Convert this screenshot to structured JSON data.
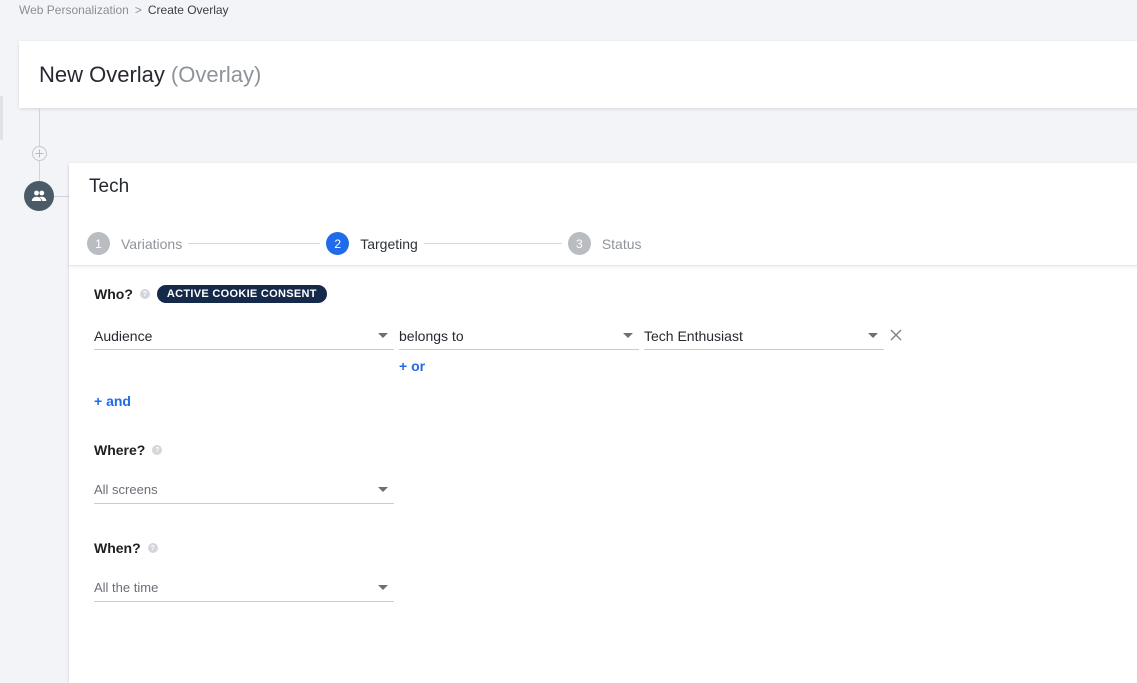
{
  "breadcrumb": {
    "parent": "Web Personalization",
    "separator": ">",
    "current": "Create Overlay"
  },
  "header": {
    "title": "New Overlay",
    "type_label": "(Overlay)"
  },
  "timeline": {
    "add_icon": "plus-icon",
    "node_icon": "people-icon"
  },
  "card": {
    "title": "Tech",
    "steps": [
      {
        "number": "1",
        "label": "Variations",
        "active": false
      },
      {
        "number": "2",
        "label": "Targeting",
        "active": true
      },
      {
        "number": "3",
        "label": "Status",
        "active": false
      }
    ]
  },
  "who": {
    "label": "Who?",
    "help": "?",
    "badge": "ACTIVE COOKIE CONSENT",
    "condition": {
      "field": "Audience",
      "operator": "belongs to",
      "value": "Tech Enthusiast"
    },
    "or_label": "+ or",
    "and_label": "+ and"
  },
  "where": {
    "label": "Where?",
    "help": "?",
    "value": "All screens"
  },
  "when": {
    "label": "When?",
    "help": "?",
    "value": "All the time"
  },
  "colors": {
    "accent": "#1f6bea",
    "badge_bg": "#15294a",
    "node_bg": "#4a5a66"
  }
}
